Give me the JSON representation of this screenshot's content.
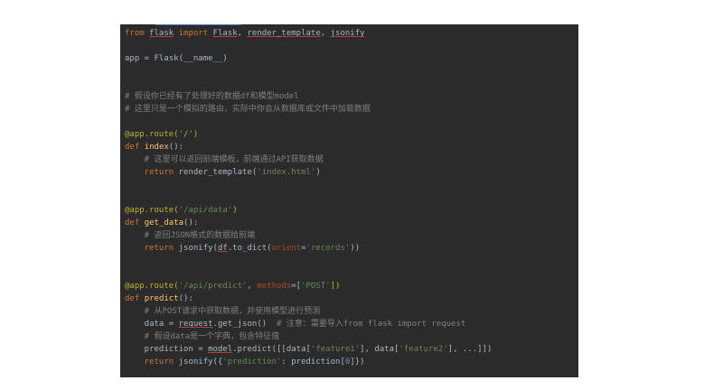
{
  "code": {
    "line1": {
      "kw_from": "from ",
      "mod": "flask",
      "kw_import": " import ",
      "cls": "Flask",
      "rest1": ", ",
      "rt": "render_template",
      "rest2": ", ",
      "js": "jsonify"
    },
    "line3": {
      "text": "app = Flask(__name__)"
    },
    "line6": {
      "text": "# 假设你已经有了处理好的数据df和模型model"
    },
    "line7": {
      "text": "# 这里只是一个模拟的路由，实际中你会从数据库或文件中加载数据"
    },
    "line9": {
      "text": "@app.route('/')"
    },
    "line10": {
      "kw": "def ",
      "fn": "index",
      "rest": "():"
    },
    "line11": {
      "text": "    # 这里可以返回前端模板，前端通过API获取数据"
    },
    "line12": {
      "kw": "    return ",
      "pre": "render_template(",
      "str": "'index.html'",
      "post": ")"
    },
    "line15": {
      "pre": "@app.route(",
      "str": "'/api/data'",
      "post": ")"
    },
    "line16": {
      "kw": "def ",
      "fn": "get_data",
      "rest": "():"
    },
    "line17": {
      "text": "    # 返回JSON格式的数据给前端"
    },
    "line18": {
      "kw": "    return ",
      "pre": "jsonify(",
      "df": "df",
      "mid": ".to_dict(",
      "param": "orient",
      "eq": "=",
      "str": "'records'",
      "post": "))"
    },
    "line21": {
      "pre": "@app.route(",
      "str": "'/api/predict'",
      "comma": ", ",
      "param": "methods",
      "eq": "=[",
      "str2": "'POST'",
      "post": "])"
    },
    "line22": {
      "kw": "def ",
      "fn": "predict",
      "rest": "():"
    },
    "line23": {
      "text": "    # 从POST请求中获取数据，并使用模型进行预测"
    },
    "line24": {
      "pre": "    data = ",
      "req": "request",
      "mid": ".get_json()  ",
      "cmt": "# 注意：需要导入from flask import request"
    },
    "line25": {
      "text": "    # 假设data是一个字典，包含特征值"
    },
    "line26": {
      "pre": "    prediction = ",
      "model": "model",
      "mid": ".predict([[data[",
      "s1": "'feature1'",
      "mid2": "], data[",
      "s2": "'feature2'",
      "post": "], ...]])"
    },
    "line27": {
      "kw": "    return ",
      "pre": "jsonify({",
      "str": "'prediction'",
      "mid": ": prediction[",
      "num": "0",
      "post": "]})"
    }
  }
}
